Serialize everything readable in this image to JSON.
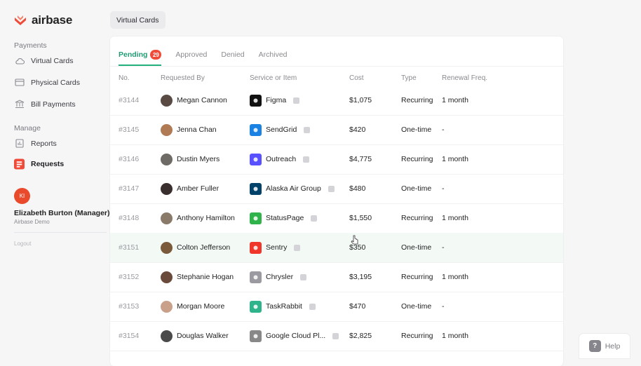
{
  "brand": {
    "name": "airbase",
    "color": "#ef4b38"
  },
  "sidebar": {
    "sections": [
      {
        "label": "Payments",
        "items": [
          {
            "label": "Virtual Cards",
            "icon": "cloud-icon",
            "active": false
          },
          {
            "label": "Physical Cards",
            "icon": "card-icon",
            "active": false
          },
          {
            "label": "Bill Payments",
            "icon": "bank-icon",
            "active": false
          }
        ]
      },
      {
        "label": "Manage",
        "items": [
          {
            "label": "Reports",
            "icon": "report-icon",
            "active": false
          },
          {
            "label": "Requests",
            "icon": "requests-icon",
            "active": true
          }
        ]
      }
    ],
    "user": {
      "initials": "KI",
      "name": "Elizabeth Burton (Manager)",
      "org": "Airbase Demo"
    },
    "logout": "Logout"
  },
  "breadcrumb": "Virtual Cards",
  "tabs": [
    {
      "label": "Pending",
      "badge": "29",
      "active": true
    },
    {
      "label": "Approved",
      "active": false
    },
    {
      "label": "Denied",
      "active": false
    },
    {
      "label": "Archived",
      "active": false
    }
  ],
  "table": {
    "headers": [
      "No.",
      "Requested By",
      "Service or Item",
      "Cost",
      "Type",
      "Renewal Freq."
    ],
    "rows": [
      {
        "no": "#3144",
        "by": "Megan Cannon",
        "service": "Figma",
        "cost": "$1,075",
        "type": "Recurring",
        "renewal": "1 month",
        "avatar_color": "#5a4a44",
        "logo_color": "#111111",
        "logo_icon": "figma-logo"
      },
      {
        "no": "#3145",
        "by": "Jenna Chan",
        "service": "SendGrid",
        "cost": "$420",
        "type": "One-time",
        "renewal": "-",
        "avatar_color": "#b07a55",
        "logo_color": "#1a82e2",
        "logo_icon": "sendgrid-logo"
      },
      {
        "no": "#3146",
        "by": "Dustin Myers",
        "service": "Outreach",
        "cost": "$4,775",
        "type": "Recurring",
        "renewal": "1 month",
        "avatar_color": "#6e6a66",
        "logo_color": "#5951ff",
        "logo_icon": "outreach-logo"
      },
      {
        "no": "#3147",
        "by": "Amber Fuller",
        "service": "Alaska Air Group",
        "cost": "$480",
        "type": "One-time",
        "renewal": "-",
        "avatar_color": "#3a2f2f",
        "logo_color": "#01426a",
        "logo_icon": "alaska-air-logo"
      },
      {
        "no": "#3148",
        "by": "Anthony Hamilton",
        "service": "StatusPage",
        "cost": "$1,550",
        "type": "Recurring",
        "renewal": "1 month",
        "avatar_color": "#8a7a6a",
        "logo_color": "#2fb34a",
        "logo_icon": "statuspage-logo"
      },
      {
        "no": "#3151",
        "by": "Colton Jefferson",
        "service": "Sentry",
        "cost": "$350",
        "type": "One-time",
        "renewal": "-",
        "avatar_color": "#7a5a3a",
        "logo_color": "#f0352b",
        "logo_icon": "sentry-logo"
      },
      {
        "no": "#3152",
        "by": "Stephanie Hogan",
        "service": "Chrysler",
        "cost": "$3,195",
        "type": "Recurring",
        "renewal": "1 month",
        "avatar_color": "#6a4a3a",
        "logo_color": "#9a9aa0",
        "logo_icon": "chrysler-logo"
      },
      {
        "no": "#3153",
        "by": "Morgan Moore",
        "service": "TaskRabbit",
        "cost": "$470",
        "type": "One-time",
        "renewal": "-",
        "avatar_color": "#c9a08a",
        "logo_color": "#2fb38a",
        "logo_icon": "taskrabbit-logo"
      },
      {
        "no": "#3154",
        "by": "Douglas Walker",
        "service": "Google Cloud Pl...",
        "cost": "$2,825",
        "type": "Recurring",
        "renewal": "1 month",
        "avatar_color": "#4a4a4a",
        "logo_color": "#888888",
        "logo_icon": "google-cloud-logo"
      }
    ],
    "hover_row": 5
  },
  "help": {
    "icon": "?",
    "label": "Help"
  }
}
